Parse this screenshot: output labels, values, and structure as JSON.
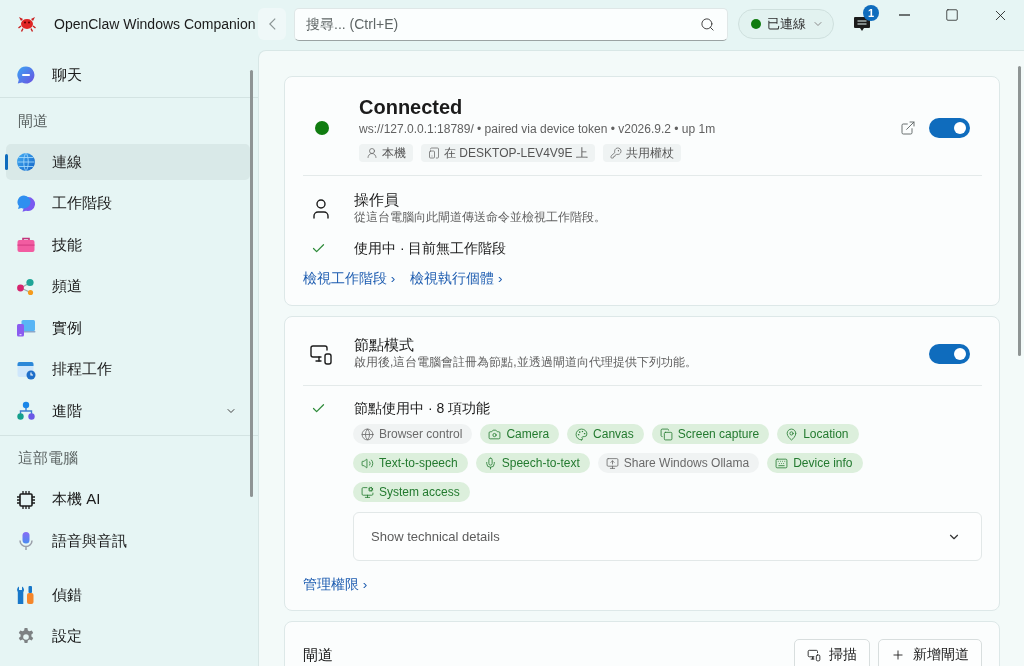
{
  "window": {
    "title": "OpenClaw Windows Companion"
  },
  "search": {
    "placeholder": "搜尋... (Ctrl+E)"
  },
  "status_pill": {
    "label": "已連線",
    "connected": true
  },
  "notifications": {
    "count": "1"
  },
  "sidebar": {
    "top_items": [
      {
        "label": "聊天",
        "selected": false
      }
    ],
    "sections": [
      {
        "title": "閘道",
        "items": [
          {
            "label": "連線",
            "selected": true,
            "kind": "link"
          },
          {
            "label": "工作階段",
            "selected": false,
            "kind": "link"
          },
          {
            "label": "技能",
            "selected": false,
            "kind": "link"
          },
          {
            "label": "頻道",
            "selected": false,
            "kind": "link"
          },
          {
            "label": "實例",
            "selected": false,
            "kind": "link"
          },
          {
            "label": "排程工作",
            "selected": false,
            "kind": "link"
          },
          {
            "label": "進階",
            "selected": false,
            "kind": "group",
            "expanded": false
          }
        ]
      },
      {
        "title": "這部電腦",
        "items": [
          {
            "label": "本機 AI",
            "selected": false,
            "kind": "link"
          },
          {
            "label": "語音與音訊",
            "selected": false,
            "kind": "link"
          }
        ]
      }
    ],
    "footer_items": [
      {
        "label": "偵錯",
        "selected": false
      },
      {
        "label": "設定",
        "selected": false
      }
    ]
  },
  "connection_card": {
    "title": "Connected",
    "connected": true,
    "details": "ws://127.0.0.1:18789/ • paired via device token • v2026.9.2 • up 1m",
    "chips": [
      "本機",
      "在 DESKTOP-LEV4V9E 上",
      "共用權杖"
    ],
    "toggle": {
      "on": true
    },
    "operator": {
      "title": "操作員",
      "description": "從這台電腦向此閘道傳送命令並檢視工作階段。",
      "active": true,
      "status": "使用中 · 目前無工作階段",
      "links": [
        "檢視工作階段 ›",
        "檢視執行個體 ›"
      ]
    }
  },
  "node_card": {
    "title": "節點模式",
    "description": "啟用後,這台電腦會註冊為節點,並透過閘道向代理提供下列功能。",
    "toggle": {
      "on": true
    },
    "active": true,
    "status": "節點使用中 · 8 項功能",
    "features": [
      {
        "label": "Browser control",
        "enabled": false
      },
      {
        "label": "Camera",
        "enabled": true
      },
      {
        "label": "Canvas",
        "enabled": true
      },
      {
        "label": "Screen capture",
        "enabled": true
      },
      {
        "label": "Location",
        "enabled": true
      },
      {
        "label": "Text-to-speech",
        "enabled": true
      },
      {
        "label": "Speech-to-text",
        "enabled": true
      },
      {
        "label": "Share Windows Ollama",
        "enabled": false
      },
      {
        "label": "Device info",
        "enabled": true
      },
      {
        "label": "System access",
        "enabled": true
      }
    ],
    "details_expander": {
      "label": "Show technical details",
      "expanded": false
    },
    "link": "管理權限 ›"
  },
  "gateways_card": {
    "title": "閘道",
    "buttons": [
      "掃描",
      "新增閘道"
    ]
  }
}
